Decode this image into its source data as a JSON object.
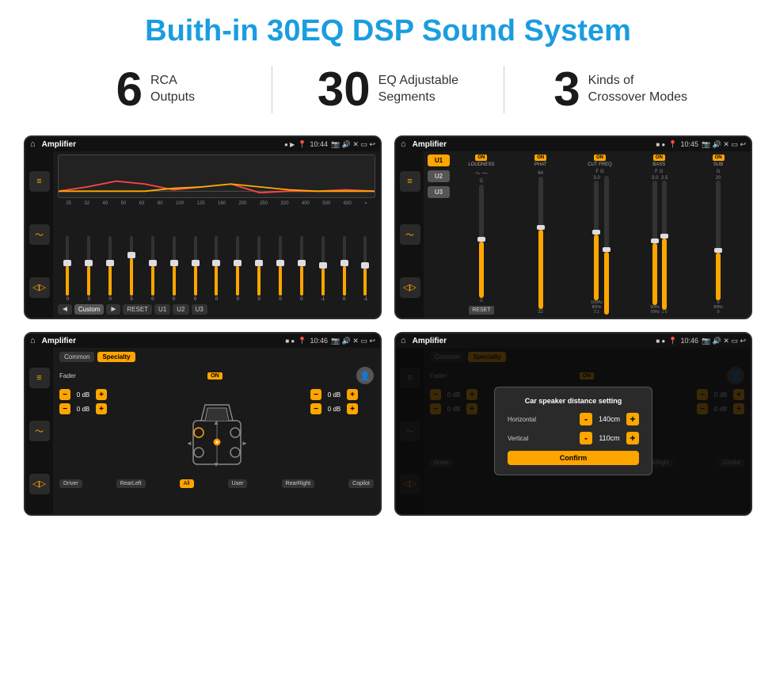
{
  "page": {
    "title": "Buith-in 30EQ DSP Sound System"
  },
  "stats": [
    {
      "number": "6",
      "label_line1": "RCA",
      "label_line2": "Outputs"
    },
    {
      "number": "30",
      "label_line1": "EQ Adjustable",
      "label_line2": "Segments"
    },
    {
      "number": "3",
      "label_line1": "Kinds of",
      "label_line2": "Crossover Modes"
    }
  ],
  "screen1": {
    "status": {
      "title": "Amplifier",
      "time": "10:44"
    },
    "freqs": [
      "25",
      "32",
      "40",
      "50",
      "63",
      "80",
      "100",
      "125",
      "160",
      "200",
      "250",
      "320",
      "400",
      "500",
      "630"
    ],
    "values": [
      "0",
      "0",
      "0",
      "5",
      "0",
      "0",
      "0",
      "0",
      "0",
      "0",
      "0",
      "0",
      "-1",
      "0",
      "-1"
    ],
    "bottom_btns": [
      "Custom",
      "RESET",
      "U1",
      "U2",
      "U3"
    ]
  },
  "screen2": {
    "status": {
      "title": "Amplifier",
      "time": "10:45"
    },
    "presets": [
      "U1",
      "U2",
      "U3"
    ],
    "channels": [
      {
        "name": "LOUDNESS",
        "on": true
      },
      {
        "name": "PHAT",
        "on": true
      },
      {
        "name": "CUT FREQ",
        "on": true
      },
      {
        "name": "BASS",
        "on": true
      },
      {
        "name": "SUB",
        "on": true
      }
    ],
    "reset": "RESET"
  },
  "screen3": {
    "status": {
      "title": "Amplifier",
      "time": "10:46"
    },
    "tabs": [
      "Common",
      "Specialty"
    ],
    "active_tab": "Specialty",
    "fader_label": "Fader",
    "on_label": "ON",
    "db_values": [
      "0 dB",
      "0 dB",
      "0 dB",
      "0 dB"
    ],
    "bottom_btns": [
      "Driver",
      "RearLeft",
      "All",
      "User",
      "RearRight",
      "Copilot"
    ]
  },
  "screen4": {
    "status": {
      "title": "Amplifier",
      "time": "10:46"
    },
    "dialog": {
      "title": "Car speaker distance setting",
      "horizontal_label": "Horizontal",
      "horizontal_value": "140cm",
      "vertical_label": "Vertical",
      "vertical_value": "110cm",
      "confirm_label": "Confirm",
      "minus_label": "-",
      "plus_label": "+"
    },
    "right_db_values": [
      "0 dB",
      "0 dB"
    ],
    "bottom_btns": [
      "Driver",
      "RearLeft",
      "User",
      "RearRight",
      "Copilot"
    ]
  }
}
